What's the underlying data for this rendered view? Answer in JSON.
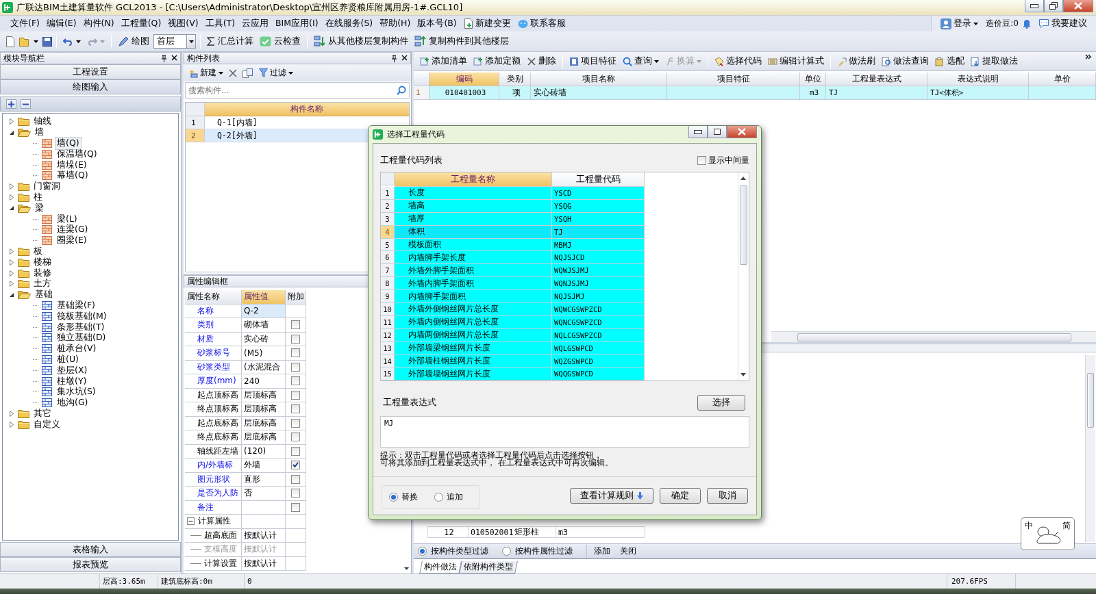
{
  "window": {
    "title": "广联达BIM土建算量软件 GCL2013 - [C:\\Users\\Administrator\\Desktop\\宣州区养贤粮库附属用房-1#.GCL10]"
  },
  "menu": [
    "文件(F)",
    "编辑(E)",
    "构件(N)",
    "工程量(Q)",
    "视图(V)",
    "工具(T)",
    "云应用",
    "BIM应用(I)",
    "在线服务(S)",
    "帮助(H)",
    "版本号(B)"
  ],
  "menu_tools": [
    "新建变更",
    "联系客服"
  ],
  "account": {
    "login": "登录",
    "beans": "造价豆:0",
    "suggest": "我要建议"
  },
  "toolbar": {
    "draw": "绘图",
    "floor": "首层",
    "sum": "汇总计算",
    "cloud_check": "云检查",
    "copy_from": "从其他楼层复制构件",
    "copy_to": "复制构件到其他楼层"
  },
  "nav": {
    "title": "模块导航栏",
    "tabs": [
      {
        "label": "工程设置",
        "selected": false
      },
      {
        "label": "绘图输入",
        "selected": true
      }
    ],
    "tree": [
      {
        "label": "轴线",
        "expanded": false,
        "selected": false
      },
      {
        "label": "墙",
        "expanded": true,
        "selected": false,
        "children": [
          {
            "label": "墙(Q)",
            "selected": true
          },
          {
            "label": "保温墙(Q)",
            "selected": false
          },
          {
            "label": "墙垛(E)",
            "selected": false
          },
          {
            "label": "幕墙(Q)",
            "selected": false
          }
        ]
      },
      {
        "label": "门窗洞",
        "expanded": false,
        "selected": false
      },
      {
        "label": "柱",
        "expanded": false,
        "selected": false
      },
      {
        "label": "梁",
        "expanded": true,
        "selected": false,
        "children": [
          {
            "label": "梁(L)",
            "selected": false
          },
          {
            "label": "连梁(G)",
            "selected": false
          },
          {
            "label": "圈梁(E)",
            "selected": false
          }
        ]
      },
      {
        "label": "板",
        "expanded": false,
        "selected": false
      },
      {
        "label": "楼梯",
        "expanded": false,
        "selected": false
      },
      {
        "label": "装修",
        "expanded": false,
        "selected": false
      },
      {
        "label": "土方",
        "expanded": false,
        "selected": false
      },
      {
        "label": "基础",
        "expanded": true,
        "selected": false,
        "children": [
          {
            "label": "基础梁(F)",
            "selected": false
          },
          {
            "label": "筏板基础(M)",
            "selected": false
          },
          {
            "label": "条形基础(T)",
            "selected": false
          },
          {
            "label": "独立基础(D)",
            "selected": false
          },
          {
            "label": "桩承台(V)",
            "selected": false
          },
          {
            "label": "桩(U)",
            "selected": false
          },
          {
            "label": "垫层(X)",
            "selected": false
          },
          {
            "label": "柱墩(Y)",
            "selected": false
          },
          {
            "label": "集水坑(S)",
            "selected": false
          },
          {
            "label": "地沟(G)",
            "selected": false
          }
        ]
      },
      {
        "label": "其它",
        "expanded": false,
        "selected": false
      },
      {
        "label": "自定义",
        "expanded": false,
        "selected": false
      }
    ],
    "bottom_tabs": [
      "表格输入",
      "报表预览"
    ]
  },
  "components": {
    "title": "构件列表",
    "new": "新建",
    "filter": "过滤",
    "search_placeholder": "搜索构件...",
    "column": "构件名称",
    "rows": [
      {
        "num": "1",
        "name": "Q-1[内墙]",
        "selected": false
      },
      {
        "num": "2",
        "name": "Q-2[外墙]",
        "selected": true
      }
    ]
  },
  "properties": {
    "title": "属性编辑框",
    "columns": [
      "属性名称",
      "属性值",
      "附加"
    ],
    "rows": [
      {
        "kind": "text",
        "name": "名称",
        "value": "Q-2",
        "emphasized": true,
        "selected": true
      },
      {
        "kind": "check",
        "name": "类别",
        "value": "砌体墙",
        "emphasized": true,
        "selected": false,
        "checked": false
      },
      {
        "kind": "check",
        "name": "材质",
        "value": "实心砖",
        "emphasized": true,
        "selected": false,
        "checked": false
      },
      {
        "kind": "check",
        "name": "砂浆标号",
        "value": "(M5)",
        "emphasized": true,
        "selected": false,
        "checked": false
      },
      {
        "kind": "check",
        "name": "砂浆类型",
        "value": "(水泥混合",
        "emphasized": true,
        "selected": false,
        "checked": false
      },
      {
        "kind": "check",
        "name": "厚度(mm)",
        "value": "240",
        "emphasized": true,
        "selected": false,
        "checked": false
      },
      {
        "kind": "check",
        "name": "起点顶标高",
        "value": "层顶标高",
        "emphasized": false,
        "selected": false,
        "checked": false
      },
      {
        "kind": "check",
        "name": "终点顶标高",
        "value": "层顶标高",
        "emphasized": false,
        "selected": false,
        "checked": false
      },
      {
        "kind": "check",
        "name": "起点底标高",
        "value": "层底标高",
        "emphasized": false,
        "selected": false,
        "checked": false
      },
      {
        "kind": "check",
        "name": "终点底标高",
        "value": "层底标高",
        "emphasized": false,
        "selected": false,
        "checked": false
      },
      {
        "kind": "check",
        "name": "轴线距左墙",
        "value": "(120)",
        "emphasized": false,
        "selected": false,
        "checked": false
      },
      {
        "kind": "check",
        "name": "内/外墙标",
        "value": "外墙",
        "emphasized": true,
        "selected": false,
        "checked": true
      },
      {
        "kind": "check",
        "name": "图元形状",
        "value": "直形",
        "emphasized": true,
        "selected": false,
        "checked": false
      },
      {
        "kind": "check",
        "name": "是否为人防",
        "value": "否",
        "emphasized": true,
        "selected": false,
        "checked": false
      },
      {
        "kind": "check",
        "name": "备注",
        "emphasized": true,
        "selected": false,
        "checked": false
      },
      {
        "kind": "group",
        "name": "计算属性",
        "expanded": true,
        "children": [
          {
            "kind": "text",
            "name": "超高底面",
            "value": "按默认计",
            "disabled": false
          },
          {
            "kind": "text",
            "name": "支模高度",
            "value": "按默认计",
            "disabled": true
          },
          {
            "kind": "text",
            "name": "计算设置",
            "value": "按默认计",
            "disabled": false
          }
        ]
      }
    ]
  },
  "quota": {
    "toolbar": [
      {
        "kind": "button",
        "label": "添加清单",
        "disabled": false
      },
      {
        "kind": "button",
        "label": "添加定额",
        "disabled": false
      },
      {
        "kind": "button",
        "label": "删除",
        "disabled": false
      },
      {
        "kind": "button",
        "label": "项目特征",
        "disabled": false
      },
      {
        "kind": "menu",
        "label": "查询",
        "disabled": false
      },
      {
        "kind": "menu",
        "label": "换算",
        "disabled": true
      },
      {
        "kind": "button",
        "label": "选择代码",
        "disabled": false
      },
      {
        "kind": "button",
        "label": "编辑计算式",
        "disabled": false
      },
      {
        "kind": "button",
        "label": "做法刷",
        "disabled": false
      },
      {
        "kind": "button",
        "label": "做法查询",
        "disabled": false
      },
      {
        "kind": "button",
        "label": "选配",
        "disabled": false
      },
      {
        "kind": "button",
        "label": "提取做法",
        "disabled": false
      }
    ],
    "columns": [
      "编码",
      "类别",
      "项目名称",
      "项目特征",
      "单位",
      "工程量表达式",
      "表达式说明",
      "单价"
    ],
    "rows": [
      {
        "num": "1",
        "code": "010401003",
        "type": "项",
        "name": "实心砖墙",
        "unit": "m3",
        "expression": "TJ",
        "description": "TJ<体积>",
        "selected": true
      }
    ]
  },
  "lower": {
    "rows": [
      {
        "num": "12",
        "code": "010502001",
        "name": "矩形柱",
        "unit": "m3"
      }
    ],
    "filters": [
      {
        "label": "按构件类型过滤",
        "selected": true
      },
      {
        "label": "按构件属性过滤",
        "selected": false
      }
    ],
    "actions": [
      "添加",
      "关闭"
    ],
    "tabs": [
      {
        "label": "构件做法",
        "selected": true
      },
      {
        "label": "依附构件类型",
        "selected": false
      }
    ]
  },
  "ime": {
    "mode": "中",
    "script": "简"
  },
  "dialog": {
    "title": "选择工程量代码",
    "list_label": "工程量代码列表",
    "show_intermediate": {
      "label": "显示中间量",
      "checked": false
    },
    "columns": [
      "工程量名称",
      "工程量代码"
    ],
    "rows": [
      {
        "num": "1",
        "name": "长度",
        "code": "YSCD",
        "selected": false
      },
      {
        "num": "2",
        "name": "墙高",
        "code": "YSQG",
        "selected": false
      },
      {
        "num": "3",
        "name": "墙厚",
        "code": "YSQH",
        "selected": false
      },
      {
        "num": "4",
        "name": "体积",
        "code": "TJ",
        "selected": true
      },
      {
        "num": "5",
        "name": "模板面积",
        "code": "MBMJ",
        "selected": false
      },
      {
        "num": "6",
        "name": "内墙脚手架长度",
        "code": "NQJSJCD",
        "selected": false
      },
      {
        "num": "7",
        "name": "外墙外脚手架面积",
        "code": "WQWJSJMJ",
        "selected": false
      },
      {
        "num": "8",
        "name": "外墙内脚手架面积",
        "code": "WQNJSJMJ",
        "selected": false
      },
      {
        "num": "9",
        "name": "内墙脚手架面积",
        "code": "NQJSJMJ",
        "selected": false
      },
      {
        "num": "10",
        "name": "外墙外侧钢丝网片总长度",
        "code": "WQWCGSWPZCD",
        "selected": false
      },
      {
        "num": "11",
        "name": "外墙内侧钢丝网片总长度",
        "code": "WQNCGSWPZCD",
        "selected": false
      },
      {
        "num": "12",
        "name": "内墙两侧钢丝网片总长度",
        "code": "NQLCGSWPZCD",
        "selected": false
      },
      {
        "num": "13",
        "name": "外部墙梁钢丝网片长度",
        "code": "WQLGSWPCD",
        "selected": false
      },
      {
        "num": "14",
        "name": "外部墙柱钢丝网片长度",
        "code": "WQZGSWPCD",
        "selected": false
      },
      {
        "num": "15",
        "name": "外部墙墙钢丝网片长度",
        "code": "WQQGSWPCD",
        "selected": false
      }
    ],
    "expression_label": "工程量表达式",
    "select_button": "选择",
    "expression": "MJ",
    "hint": [
      "提示：双击工程量代码或者选择工程量代码后点击选择按钮，",
      "可将其添加到工程量表达式中， 在工程量表达式中可再次编辑。"
    ],
    "modes": [
      {
        "label": "替换",
        "selected": true
      },
      {
        "label": "追加",
        "selected": false
      }
    ],
    "rules_button": "查看计算规则",
    "ok_button": "确定",
    "cancel_button": "取消"
  },
  "status_bar": {
    "floor_height": "层高:3.65m",
    "base_elevation": "建筑底标高:0m",
    "value": "0",
    "fps": "207.6FPS"
  }
}
